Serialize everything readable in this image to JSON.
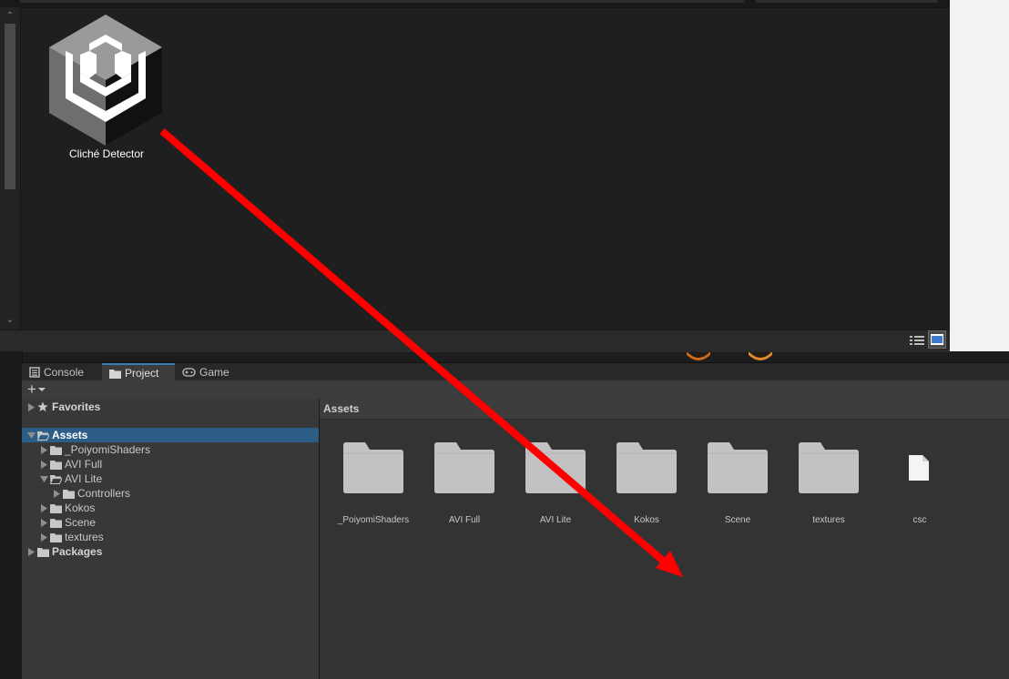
{
  "top_window": {
    "app_label": "Cliché Detector"
  },
  "editor": {
    "tabs": [
      {
        "label": "Console",
        "icon": "console-icon"
      },
      {
        "label": "Project",
        "icon": "folder-icon"
      },
      {
        "label": "Game",
        "icon": "gamepad-icon"
      }
    ],
    "toolbar": {
      "add_label": "+"
    },
    "tree": [
      {
        "label": "Favorites",
        "icon": "star-icon",
        "level": 0,
        "caret": "right",
        "bold": true
      },
      {
        "label": "Assets",
        "icon": "folder-open-icon",
        "level": 0,
        "caret": "down",
        "bold": true,
        "selected": true
      },
      {
        "label": "_PoiyomiShaders",
        "icon": "folder-icon",
        "level": 1,
        "caret": "right"
      },
      {
        "label": "AVI Full",
        "icon": "folder-icon",
        "level": 1,
        "caret": "right"
      },
      {
        "label": "AVI Lite",
        "icon": "folder-open-icon",
        "level": 1,
        "caret": "down"
      },
      {
        "label": "Controllers",
        "icon": "folder-icon",
        "level": 2,
        "caret": "right"
      },
      {
        "label": "Kokos",
        "icon": "folder-icon",
        "level": 1,
        "caret": "right"
      },
      {
        "label": "Scene",
        "icon": "folder-icon",
        "level": 1,
        "caret": "right"
      },
      {
        "label": "textures",
        "icon": "folder-icon",
        "level": 1,
        "caret": "right"
      },
      {
        "label": "Packages",
        "icon": "folder-icon",
        "level": 0,
        "caret": "right",
        "bold": true
      }
    ],
    "grid": {
      "header": "Assets",
      "items": [
        {
          "label": "_PoiyomiShaders",
          "kind": "folder"
        },
        {
          "label": "AVI Full",
          "kind": "folder"
        },
        {
          "label": "AVI Lite",
          "kind": "folder"
        },
        {
          "label": "Kokos",
          "kind": "folder"
        },
        {
          "label": "Scene",
          "kind": "folder"
        },
        {
          "label": "textures",
          "kind": "folder"
        },
        {
          "label": "csc",
          "kind": "file"
        }
      ]
    }
  },
  "colors": {
    "selection": "#2c5d87",
    "active_tab_accent": "#3a79bb",
    "annotation_arrow": "#ff0000"
  }
}
